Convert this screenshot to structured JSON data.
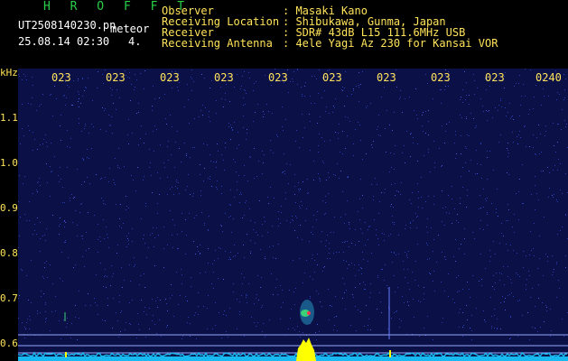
{
  "header": {
    "app_title": "H R O F F T",
    "filename": "UT2508140230.pn",
    "mode": "meteor",
    "datetime": "25.08.14 02:30",
    "count": "4.",
    "observer_label": "Observer",
    "observer_value": ": Masaki Kano",
    "location_label": "Receiving Location",
    "location_value": ": Shibukawa, Gunma, Japan",
    "receiver_label": "Receiver",
    "receiver_value": ": SDR# 43dB L15 111.6MHz USB",
    "antenna_label": "Receiving Antenna",
    "antenna_value": ": 4ele Yagi Az 230 for Kansai VOR"
  },
  "spectrogram": {
    "y_unit": "kHz",
    "y_ticks": [
      "1.1",
      "1.0",
      "0.9",
      "0.8",
      "0.7",
      "0.6"
    ],
    "x_ticks": [
      "023",
      "023",
      "023",
      "023",
      "023",
      "023",
      "023",
      "023",
      "023",
      "0240"
    ],
    "colors": {
      "background": "#0b1147",
      "noise": "#2a3bb0",
      "baseline": "#18b8f0",
      "burst": "#ffff00",
      "tick_text": "#ffe35a"
    }
  }
}
